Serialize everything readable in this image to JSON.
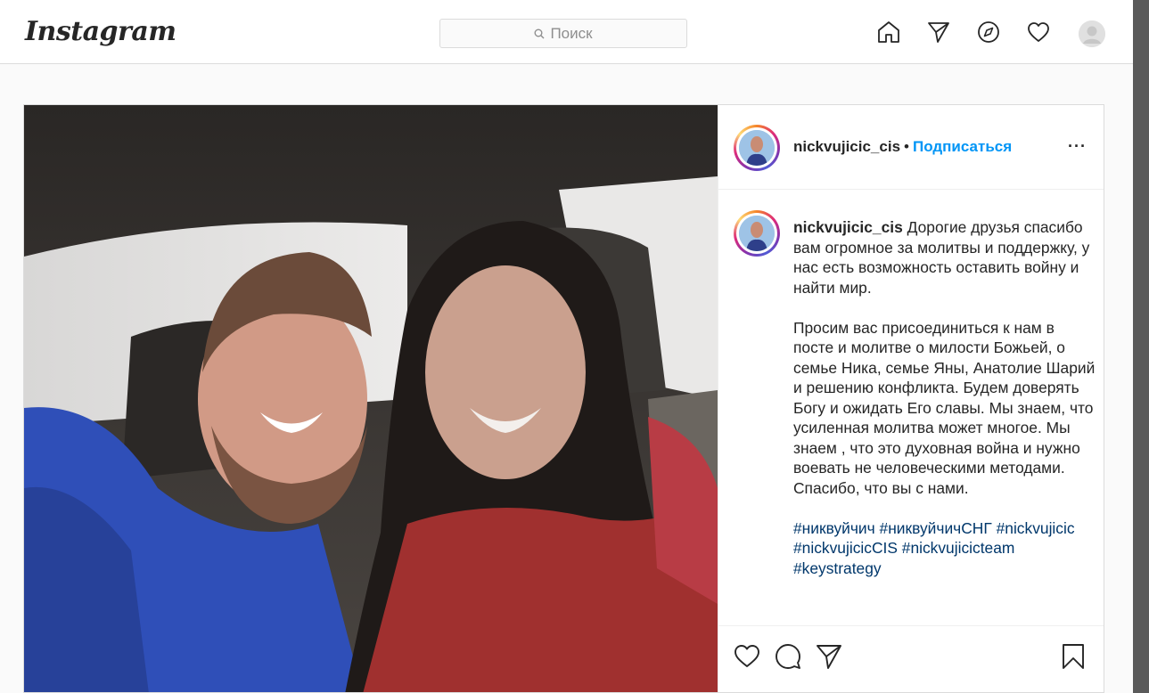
{
  "header": {
    "logo": "Instagram",
    "search_placeholder": "Поиск",
    "icons": [
      "home-icon",
      "direct-icon",
      "explore-icon",
      "activity-heart-icon",
      "profile-avatar"
    ]
  },
  "post": {
    "author": "nickvujicic_cis",
    "separator": "•",
    "follow_label": "Подписаться",
    "more_label": "···",
    "caption_author": "nickvujicic_cis",
    "caption_p1": "Дорогие друзья спасибо вам огромное за молитвы и поддержку, у нас есть возможность оставить войну и найти мир.",
    "caption_p2": "Просим вас присоединиться к нам в посте и молитве о милости Божьей, о семье Ника, семье Яны, Анатолие Шарий и решению конфликта. Будем доверять Богу и ожидать Его славы. Мы знаем, что усиленная молитва может многое. Мы знаем , что это духовная война и нужно воевать не человеческими методами. Спасибо, что вы с нами.",
    "hashtags": "#никвуйчич #никвуйчичСНГ #nickvujicic #nickvujicicCIS #nickvujicicteam #keystrategy",
    "actions": [
      "like-icon",
      "comment-icon",
      "share-icon",
      "save-icon"
    ]
  },
  "colors": {
    "link_blue": "#0095f6",
    "hashtag": "#00376b",
    "border": "#dbdbdb",
    "background": "#fafafa"
  }
}
